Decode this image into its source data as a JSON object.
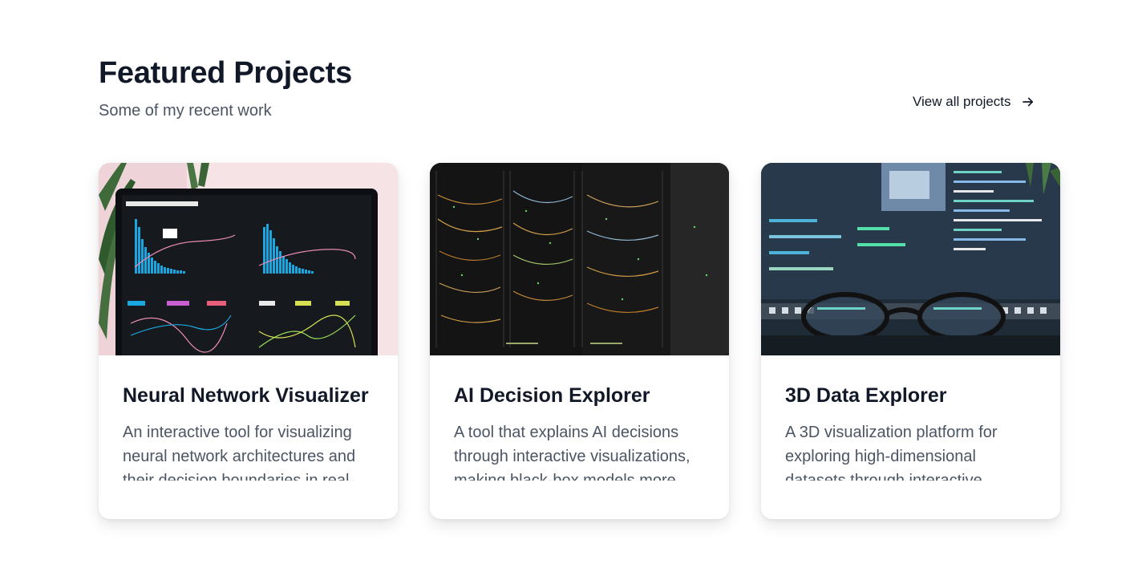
{
  "section": {
    "title": "Featured Projects",
    "subtitle": "Some of my recent work",
    "view_all_label": "View all projects"
  },
  "projects": [
    {
      "title": "Neural Network Visualizer",
      "description": "An interactive tool for visualizing neural network architectures and their decision boundaries in real-time.",
      "image_icon": "analytics-dashboard-photo"
    },
    {
      "title": "AI Decision Explorer",
      "description": "A tool that explains AI decisions through interactive visualizations, making black-box models more transparent.",
      "image_icon": "server-rack-photo"
    },
    {
      "title": "3D Data Explorer",
      "description": "A 3D visualization platform for exploring high-dimensional datasets through interactive controls.",
      "image_icon": "code-screen-glasses-photo"
    }
  ],
  "colors": {
    "heading": "#111827",
    "body_text": "#4b5563",
    "card_bg": "#ffffff"
  }
}
